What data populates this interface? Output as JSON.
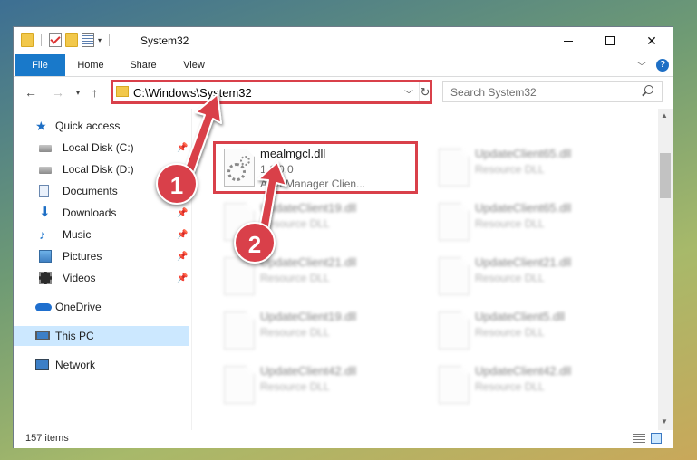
{
  "window": {
    "title": "System32"
  },
  "ribbon": {
    "tabs": [
      "File",
      "Home",
      "Share",
      "View"
    ],
    "help": "?"
  },
  "address": {
    "path": "C:\\Windows\\System32",
    "search_placeholder": "Search System32"
  },
  "sidebar": {
    "items": [
      {
        "label": "Quick access",
        "icon": "star-icon"
      },
      {
        "label": "Local Disk (C:)",
        "icon": "drive-icon",
        "pinned": true
      },
      {
        "label": "Local Disk (D:)",
        "icon": "drive-icon"
      },
      {
        "label": "Documents",
        "icon": "documents-icon",
        "pinned": true
      },
      {
        "label": "Downloads",
        "icon": "download-icon",
        "pinned": true
      },
      {
        "label": "Music",
        "icon": "music-icon",
        "pinned": true
      },
      {
        "label": "Pictures",
        "icon": "pictures-icon",
        "pinned": true
      },
      {
        "label": "Videos",
        "icon": "videos-icon",
        "pinned": true
      },
      {
        "label": "OneDrive",
        "icon": "cloud-icon"
      },
      {
        "label": "This PC",
        "icon": "computer-icon",
        "selected": true
      },
      {
        "label": "Network",
        "icon": "network-icon"
      }
    ]
  },
  "files": [
    {
      "name": "mealmgcl.dll",
      "line1": "1.1.0.0",
      "line2": "Alert Manager Clien...",
      "highlighted": true
    },
    {
      "name": "UpdateClient65.dll",
      "line1": "Resource DLL",
      "blurred": true
    },
    {
      "name": "UpdateClient19.dll",
      "line1": "Resource DLL",
      "blurred": true
    },
    {
      "name": "UpdateClient65.dll",
      "line1": "Resource DLL",
      "blurred": true
    },
    {
      "name": "UpdateClient21.dll",
      "line1": "Resource DLL",
      "blurred": true
    },
    {
      "name": "UpdateClient21.dll",
      "line1": "Resource DLL",
      "blurred": true
    },
    {
      "name": "UpdateClient19.dll",
      "line1": "Resource DLL",
      "blurred": true
    },
    {
      "name": "UpdateClient5.dll",
      "line1": "Resource DLL",
      "blurred": true
    },
    {
      "name": "UpdateClient42.dll",
      "line1": "Resource DLL",
      "blurred": true
    },
    {
      "name": "UpdateClient42.dll",
      "line1": "Resource DLL",
      "blurred": true
    }
  ],
  "status": {
    "item_count": "157 items"
  },
  "annotations": {
    "badge1": "1",
    "badge2": "2",
    "color": "#d9404a"
  }
}
